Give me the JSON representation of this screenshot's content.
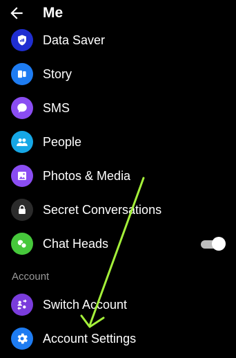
{
  "header": {
    "title": "Me"
  },
  "items": [
    {
      "label": "Data Saver",
      "icon": "data-saver-icon",
      "color": "#1f2ed1"
    },
    {
      "label": "Story",
      "icon": "story-icon",
      "color": "#1e7cf2"
    },
    {
      "label": "SMS",
      "icon": "sms-icon",
      "color": "#8a4df2"
    },
    {
      "label": "People",
      "icon": "people-icon",
      "color": "#16a7e6"
    },
    {
      "label": "Photos & Media",
      "icon": "photos-icon",
      "color": "#8a4df2"
    },
    {
      "label": "Secret Conversations",
      "icon": "lock-icon",
      "color": "#2b2b2b"
    },
    {
      "label": "Chat Heads",
      "icon": "chat-heads-icon",
      "color": "#46c83b",
      "toggle": "on"
    }
  ],
  "account_section": {
    "title": "Account",
    "items": [
      {
        "label": "Switch Account",
        "icon": "switch-account-icon",
        "color": "#7a3cdc"
      },
      {
        "label": "Account Settings",
        "icon": "gear-icon",
        "color": "#1e7cf2"
      }
    ]
  },
  "annotation": {
    "arrow_color": "#a4f03a"
  }
}
